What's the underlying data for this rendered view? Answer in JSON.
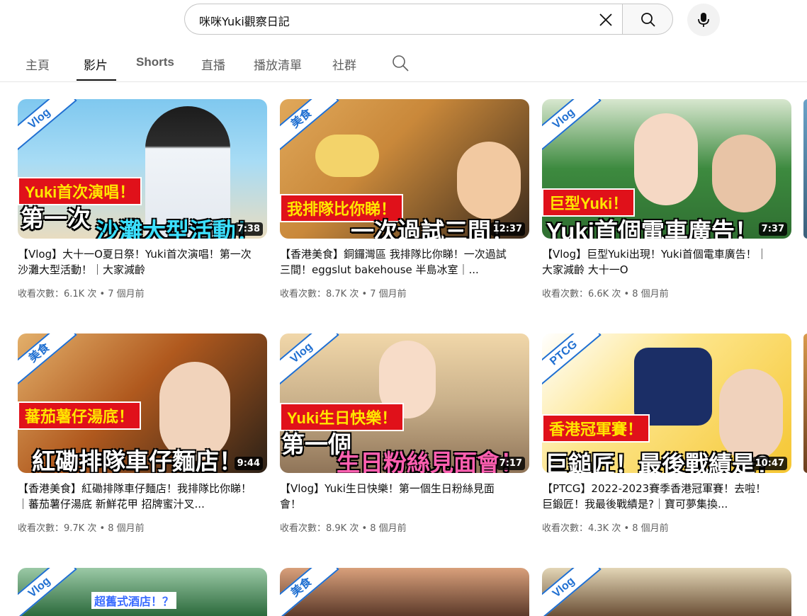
{
  "search": {
    "query": "咪咪Yuki觀察日記"
  },
  "icons": {
    "clear": "close-icon",
    "search": "search-icon",
    "mic": "microphone-icon",
    "tab_search": "search-icon"
  },
  "tabs": [
    {
      "label": "主頁"
    },
    {
      "label": "影片"
    },
    {
      "label": "Shorts"
    },
    {
      "label": "直播"
    },
    {
      "label": "播放清單"
    },
    {
      "label": "社群"
    }
  ],
  "videos": [
    {
      "ribbon": "Vlog",
      "overlay_top": "Yuki首次演唱！",
      "overlay_bottom_a": "第一次",
      "overlay_bottom_b": "沙灘大型活動！",
      "duration": "7:38",
      "title": "【Vlog】大十一O夏日祭！Yuki首次演唱！第一次沙灘大型活動！｜大家減齡",
      "meta": "收看次數：6.1K 次 • 7 個月前",
      "colors": [
        "#7fc8ef",
        "#e8dcc0"
      ]
    },
    {
      "ribbon": "美食",
      "overlay_top": "我排隊比你睇！",
      "overlay_bottom_a": "一次過試三間！",
      "overlay_bottom_b": "",
      "duration": "12:37",
      "title": "【香港美食】銅鑼灣區 我排隊比你睇！一次過試三間！eggslut bakehouse 半島冰室｜...",
      "meta": "收看次數：8.7K 次 • 7 個月前",
      "colors": [
        "#c9883a",
        "#3a2a1c"
      ]
    },
    {
      "ribbon": "Vlog",
      "overlay_top": "巨型Yuki！",
      "overlay_bottom_a": "Yuki首個電車廣告！",
      "overlay_bottom_b": "",
      "duration": "7:37",
      "title": "【Vlog】巨型Yuki出現！Yuki首個電車廣告！｜大家減齡 大十一O",
      "meta": "收看次數：6.6K 次 • 8 個月前",
      "colors": [
        "#3d8a3f",
        "#d8e7cf"
      ]
    },
    {
      "ribbon": "美食",
      "overlay_top": "蕃茄薯仔湯底！",
      "overlay_bottom_a": "紅磡排隊車仔麵店！",
      "overlay_bottom_b": "",
      "duration": "9:44",
      "title": "【香港美食】紅磡排隊車仔麵店！我排隊比你睇！｜蕃茄薯仔湯底 新鮮花甲 招牌蜜汁叉...",
      "meta": "收看次數：9.7K 次 • 8 個月前",
      "colors": [
        "#b0591e",
        "#2c2117"
      ]
    },
    {
      "ribbon": "Vlog",
      "overlay_top": "Yuki生日快樂！",
      "overlay_bottom_a": "第一個",
      "overlay_bottom_b": "生日粉絲見面會！",
      "duration": "7:17",
      "title": "【Vlog】Yuki生日快樂！第一個生日粉絲見面會！",
      "meta": "收看次數：8.9K 次 • 8 個月前",
      "colors": [
        "#f1d7a9",
        "#8f7458"
      ]
    },
    {
      "ribbon": "PTCG",
      "overlay_top": "香港冠軍賽！",
      "overlay_bottom_a": "巨鎚匠！最後戰績是?",
      "overlay_bottom_b": "",
      "duration": "10:47",
      "title": "【PTCG】2022-2023賽季香港冠軍賽！去啦！巨鍛匠！我最後戰績是?｜寶可夢集換...",
      "meta": "收看次數：4.3K 次 • 8 個月前",
      "colors": [
        "#f5c632",
        "#ffffff"
      ]
    },
    {
      "ribbon": "Vlog",
      "overlay_top": "超舊式酒店！？",
      "colors": [
        "#9bc9a6",
        "#2c6a3c"
      ]
    },
    {
      "ribbon": "美食",
      "overlay_top": "",
      "colors": [
        "#d9a07b",
        "#5c3a2a"
      ]
    },
    {
      "ribbon": "Vlog",
      "overlay_top": "",
      "colors": [
        "#e3d6b6",
        "#6b4f36"
      ]
    }
  ]
}
